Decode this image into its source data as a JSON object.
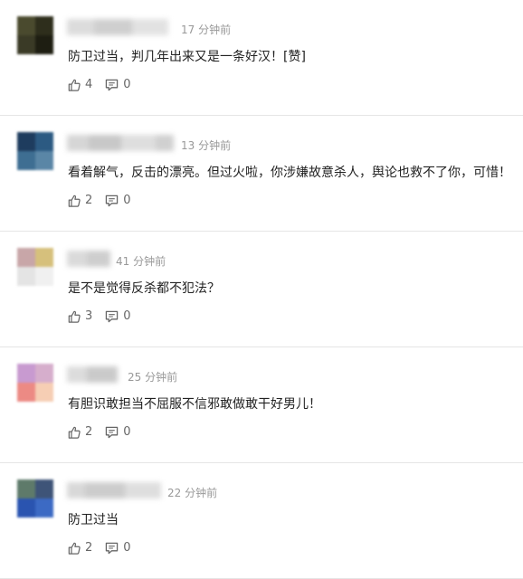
{
  "comments": [
    {
      "time": "17 分钟前",
      "text": "防卫过当，判几年出来又是一条好汉！[赞]",
      "likes": "4",
      "replies": "0",
      "avatar_colors": [
        "#4a4a2e",
        "#2e2e1c",
        "#3a3a26",
        "#1e1e12"
      ]
    },
    {
      "time": "13 分钟前",
      "text": "看着解气，反击的漂亮。但过火啦，你涉嫌故意杀人，舆论也救不了你，可惜！",
      "likes": "2",
      "replies": "0",
      "avatar_colors": [
        "#1e3c5e",
        "#2c5a82",
        "#3e6e92",
        "#5a86a6"
      ]
    },
    {
      "time": "41 分钟前",
      "text": "是不是觉得反杀都不犯法？",
      "likes": "3",
      "replies": "0",
      "avatar_colors": [
        "#c8a6a8",
        "#d6c07c",
        "#e4e4e4",
        "#f0f0f0"
      ]
    },
    {
      "time": "25 分钟前",
      "text": "有胆识敢担当不屈服不信邪敢做敢干好男儿！",
      "likes": "2",
      "replies": "0",
      "avatar_colors": [
        "#c89ad0",
        "#d6aecc",
        "#ec8a84",
        "#f6ceb4"
      ]
    },
    {
      "time": "22 分钟前",
      "text": "防卫过当",
      "likes": "2",
      "replies": "0",
      "avatar_colors": [
        "#5e7a6a",
        "#3e5478",
        "#2a54b0",
        "#3c6ac4"
      ]
    }
  ],
  "icons": {
    "like": "thumbs-up-icon",
    "reply": "comment-bubble-icon"
  },
  "colors": {
    "text": "#222222",
    "meta": "#999999",
    "count": "#666666",
    "divider": "#e5e5e5"
  }
}
